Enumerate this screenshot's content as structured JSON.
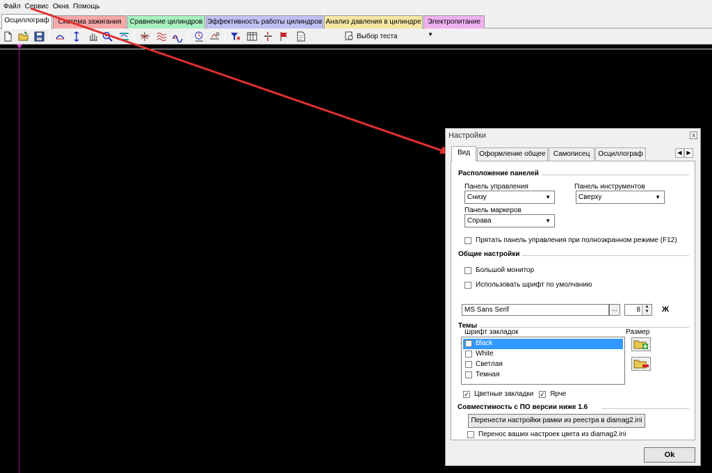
{
  "menu": [
    "Файл",
    "Сервис",
    "Окна",
    "Помощь"
  ],
  "app_tabs": [
    {
      "label": "Осциллограф",
      "color": "#ffffff",
      "active": true
    },
    {
      "label": "Система зажигания",
      "color": "#f7a8a8"
    },
    {
      "label": "Сравнение цилиндров",
      "color": "#a8f0c0"
    },
    {
      "label": "Эффективность работы цилиндров",
      "color": "#c0c0f4"
    },
    {
      "label": "Анализ давления в цилиндре",
      "color": "#f6e6a4"
    },
    {
      "label": "Электропитание",
      "color": "#f0b0f0"
    }
  ],
  "toolbar": {
    "test_select": "Выбор теста"
  },
  "dialog": {
    "title": "Настройки",
    "close": "x",
    "tabs": [
      "Вид",
      "Оформление общее",
      "Самописец",
      "Осциллограф"
    ],
    "panels_section": {
      "title": "Расположение панелей",
      "control_panel_label": "Панель управления",
      "control_panel_value": "Снизу",
      "tools_panel_label": "Панель инструментов",
      "tools_panel_value": "Сверху",
      "markers_panel_label": "Панель маркеров",
      "markers_panel_value": "Справа",
      "hide_fullscreen_label": "Прятать панель управления при полноэкранном режиме (F12)",
      "hide_fullscreen_checked": false
    },
    "general_section": {
      "title": "Общие настройки",
      "big_monitor_label": "Большой монитор",
      "big_monitor_checked": false,
      "default_font_label": "Использовать шрифт по умолчанию",
      "default_font_checked": false,
      "tab_font_label": "Шрифт закладок",
      "tab_font_value": "MS Sans Serif",
      "dots": "...",
      "size_label": "Размер",
      "size_value": "8",
      "bold_label": "Ж"
    },
    "themes_section": {
      "title": "Темы",
      "items": [
        {
          "label": "Black",
          "checked": true,
          "selected": true
        },
        {
          "label": "White",
          "checked": false
        },
        {
          "label": "Светлая",
          "checked": false
        },
        {
          "label": "Темная",
          "checked": false
        }
      ],
      "colored_tabs_label": "Цветные закладки",
      "colored_tabs_checked": true,
      "brighter_label": "Ярче",
      "brighter_checked": true
    },
    "compat_section": {
      "title": "Совместимость с ПО версии ниже 1.6",
      "migrate_button": "Перенести настройки рамки из реестра в diamag2.ini",
      "transfer_colors_label": "Перенос ваших настроек цвета из diamag2.ini",
      "transfer_colors_checked": false
    },
    "ok_button": "Ok"
  },
  "annotation_color": "#e03030"
}
